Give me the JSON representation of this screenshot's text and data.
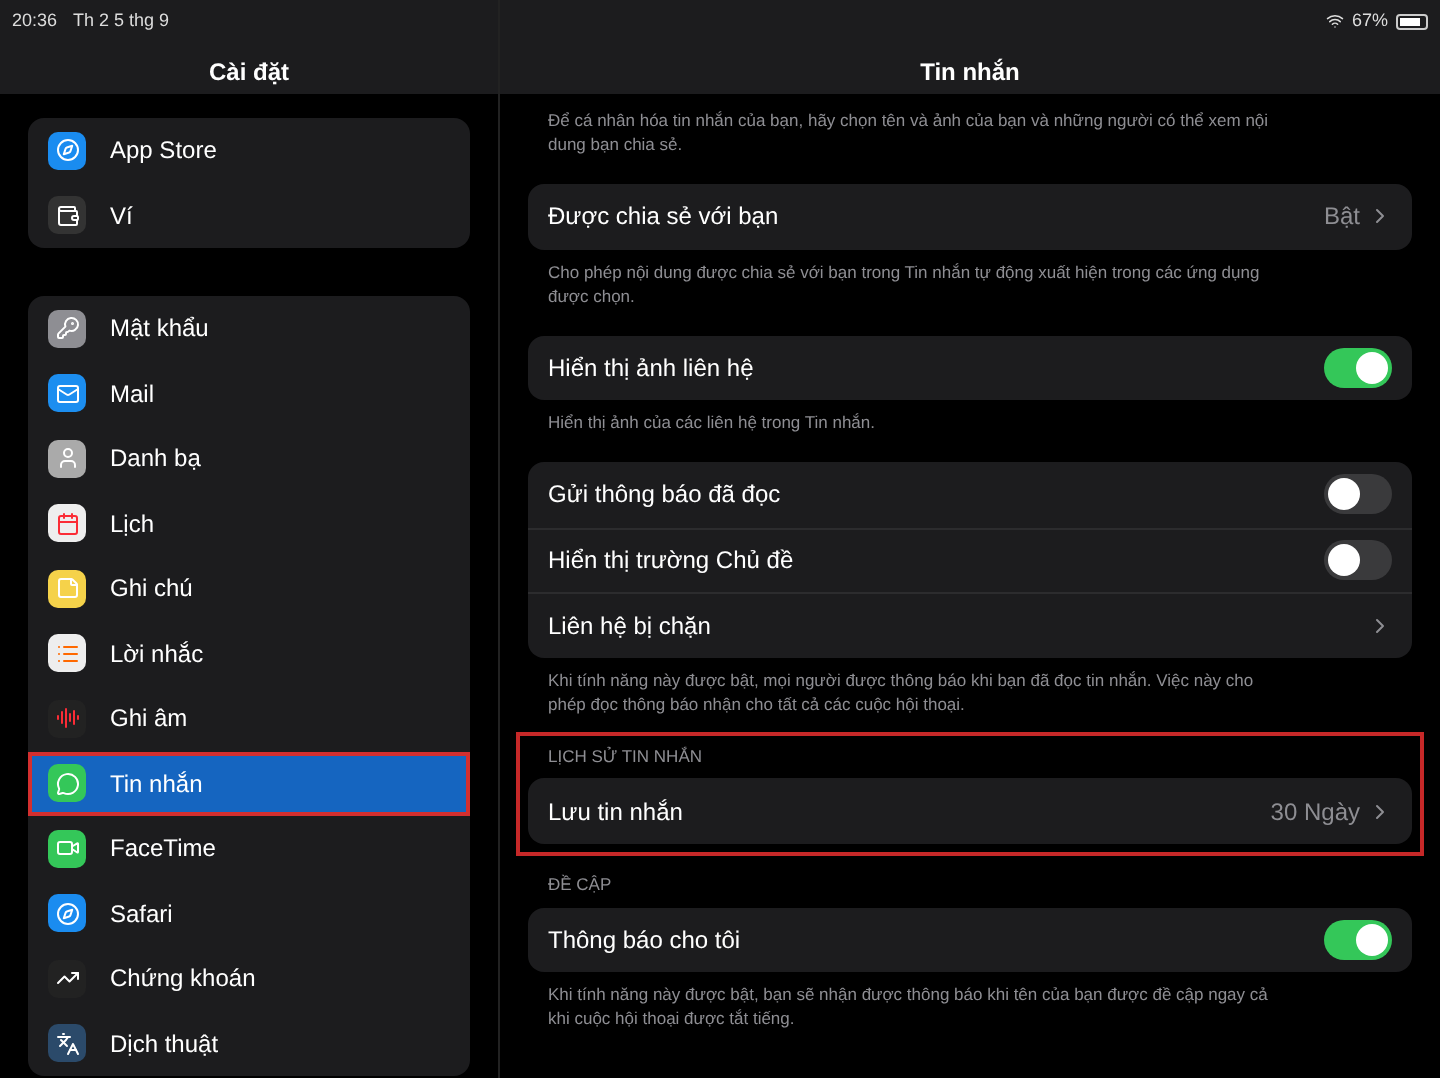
{
  "status_bar": {
    "time": "20:36",
    "date": "Th 2 5 thg 9",
    "battery": "67%"
  },
  "sidebar": {
    "title": "Cài đặt",
    "groups": [
      {
        "items": [
          {
            "label": "App Store",
            "selected": false
          },
          {
            "label": "Ví",
            "selected": false
          }
        ]
      },
      {
        "items": [
          {
            "label": "Mật khẩu",
            "selected": false
          },
          {
            "label": "Mail",
            "selected": false
          },
          {
            "label": "Danh bạ",
            "selected": false
          },
          {
            "label": "Lịch",
            "selected": false
          },
          {
            "label": "Ghi chú",
            "selected": false
          },
          {
            "label": "Lời nhắc",
            "selected": false
          },
          {
            "label": "Ghi âm",
            "selected": false
          },
          {
            "label": "Tin nhắn",
            "selected": true
          },
          {
            "label": "FaceTime",
            "selected": false
          },
          {
            "label": "Safari",
            "selected": false
          },
          {
            "label": "Chứng khoán",
            "selected": false
          },
          {
            "label": "Dịch thuật",
            "selected": false
          }
        ]
      }
    ]
  },
  "detail": {
    "title": "Tin nhắn",
    "sections": [
      {
        "footer": "Để cá nhân hóa tin nhắn của bạn, hãy chọn tên và ảnh của bạn và những người có thể xem nội dung bạn chia sẻ."
      },
      {
        "rows": [
          {
            "kind": "value",
            "label": "Được chia sẻ với bạn",
            "value": "Bật"
          }
        ],
        "footer": "Cho phép nội dung được chia sẻ với bạn trong Tin nhắn tự động xuất hiện trong các ứng dụng được chọn."
      },
      {
        "rows": [
          {
            "kind": "toggle",
            "label": "Hiển thị ảnh liên hệ",
            "on": true
          }
        ],
        "footer": "Hiển thị ảnh của các liên hệ trong Tin nhắn."
      },
      {
        "rows": [
          {
            "kind": "toggle",
            "label": "Gửi thông báo đã đọc",
            "on": false
          },
          {
            "kind": "toggle",
            "label": "Hiển thị trường Chủ đề",
            "on": false
          },
          {
            "kind": "link",
            "label": "Liên hệ bị chặn"
          }
        ],
        "footer": "Khi tính năng này được bật, mọi người được thông báo khi bạn đã đọc tin nhắn. Việc này cho phép đọc thông báo nhận cho tất cả các cuộc hội thoại."
      },
      {
        "highlighted": true,
        "header": "LỊCH SỬ TIN NHẮN",
        "rows": [
          {
            "kind": "value",
            "label": "Lưu tin nhắn",
            "value": "30 Ngày"
          }
        ]
      },
      {
        "header": "ĐỀ CẬP",
        "rows": [
          {
            "kind": "toggle",
            "label": "Thông báo cho tôi",
            "on": true
          }
        ],
        "footer": "Khi tính năng này được bật, bạn sẽ nhận được thông báo khi tên của bạn được đề cập ngay cả khi cuộc hội thoại được tắt tiếng."
      }
    ]
  }
}
